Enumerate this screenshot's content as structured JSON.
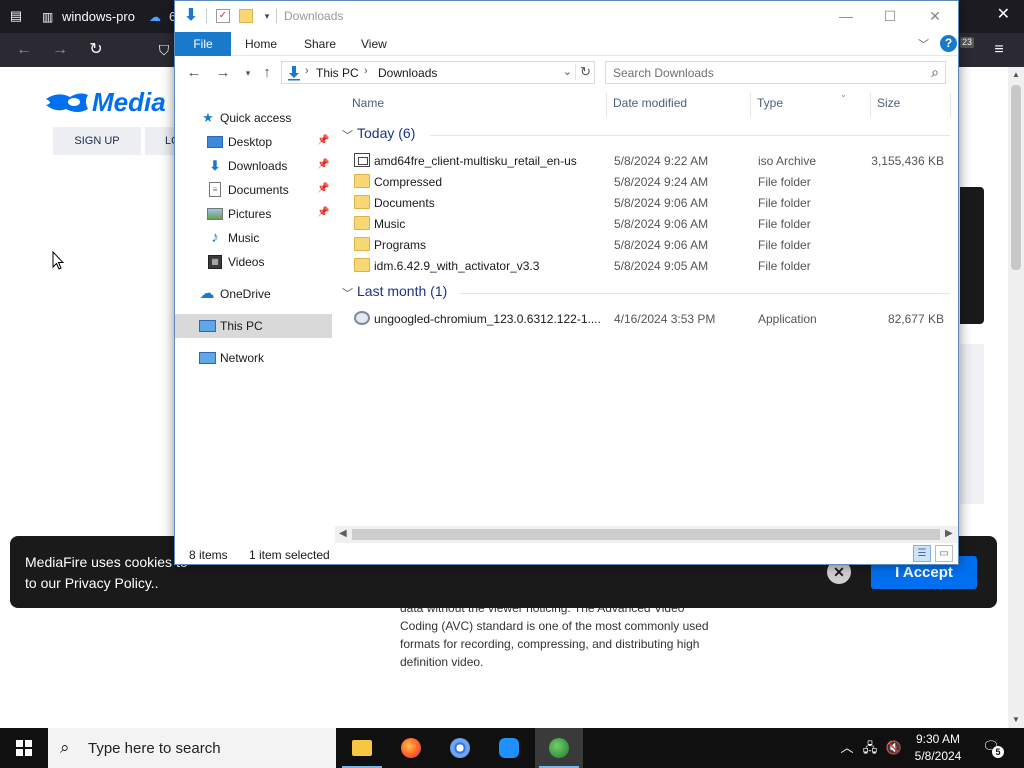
{
  "browser": {
    "tabs": [
      {
        "title": "windows-pro"
      },
      {
        "title": "6"
      }
    ],
    "icons": {
      "tab_list": "tab-list-icon",
      "close": "close-icon",
      "back": "back-arrow-icon",
      "forward": "forward-arrow-icon",
      "reload": "reload-icon",
      "shield": "shield-icon",
      "menu": "hamburger-menu-icon"
    },
    "extension_badge": "23"
  },
  "mediafire": {
    "brand": "Media",
    "signup_label": "SIGN UP",
    "login_label": "LO",
    "description": "data without the viewer noticing. The Advanced Video Coding (AVC) standard is one of the most commonly used formats for recording, compressing, and distributing high definition video.",
    "cookie_message": "MediaFire uses cookies to",
    "cookie_message_2": "to our Privacy Policy..",
    "accept_label": "I Accept",
    "brand_color": "#0070f0"
  },
  "explorer": {
    "title": "Downloads",
    "ribbon": {
      "file": "File",
      "home": "Home",
      "share": "Share",
      "view": "View",
      "help": "?"
    },
    "address": {
      "crumbs": [
        "This PC",
        "Downloads"
      ]
    },
    "search": {
      "placeholder": "Search Downloads"
    },
    "nav": [
      {
        "label": "Quick access",
        "icon": "star-icon",
        "pinned": false
      },
      {
        "label": "Desktop",
        "icon": "desktop-icon",
        "pinned": true
      },
      {
        "label": "Downloads",
        "icon": "download-icon",
        "pinned": true
      },
      {
        "label": "Documents",
        "icon": "documents-icon",
        "pinned": true
      },
      {
        "label": "Pictures",
        "icon": "pictures-icon",
        "pinned": true
      },
      {
        "label": "Music",
        "icon": "music-icon",
        "pinned": false
      },
      {
        "label": "Videos",
        "icon": "videos-icon",
        "pinned": false
      },
      {
        "label": "OneDrive",
        "icon": "cloud-icon",
        "pinned": false
      },
      {
        "label": "This PC",
        "icon": "computer-icon",
        "pinned": false,
        "selected": true
      },
      {
        "label": "Network",
        "icon": "network-icon",
        "pinned": false
      }
    ],
    "columns": {
      "name": "Name",
      "date": "Date modified",
      "type": "Type",
      "size": "Size"
    },
    "groups": [
      {
        "label": "Today (6)",
        "files": [
          {
            "name": "amd64fre_client-multisku_retail_en-us",
            "date": "5/8/2024 9:22 AM",
            "type": "iso Archive",
            "size": "3,155,436 KB",
            "icon": "iso"
          },
          {
            "name": "Compressed",
            "date": "5/8/2024 9:24 AM",
            "type": "File folder",
            "size": "",
            "icon": "folder"
          },
          {
            "name": "Documents",
            "date": "5/8/2024 9:06 AM",
            "type": "File folder",
            "size": "",
            "icon": "folder"
          },
          {
            "name": "Music",
            "date": "5/8/2024 9:06 AM",
            "type": "File folder",
            "size": "",
            "icon": "folder"
          },
          {
            "name": "Programs",
            "date": "5/8/2024 9:06 AM",
            "type": "File folder",
            "size": "",
            "icon": "folder"
          },
          {
            "name": "idm.6.42.9_with_activator_v3.3",
            "date": "5/8/2024 9:05 AM",
            "type": "File folder",
            "size": "",
            "icon": "folder"
          }
        ]
      },
      {
        "label": "Last month (1)",
        "files": [
          {
            "name": "ungoogled-chromium_123.0.6312.122-1....",
            "date": "4/16/2024 3:53 PM",
            "type": "Application",
            "size": "82,677 KB",
            "icon": "app"
          }
        ]
      }
    ],
    "status": {
      "count": "8 items",
      "selected": "1 item selected"
    }
  },
  "taskbar": {
    "search_text": "Type here to search",
    "apps": [
      "file-explorer-icon",
      "firefox-icon",
      "chrome-icon",
      "app-icon",
      "idm-icon"
    ],
    "time": "9:30 AM",
    "date": "5/8/2024",
    "notification_count": "5"
  }
}
